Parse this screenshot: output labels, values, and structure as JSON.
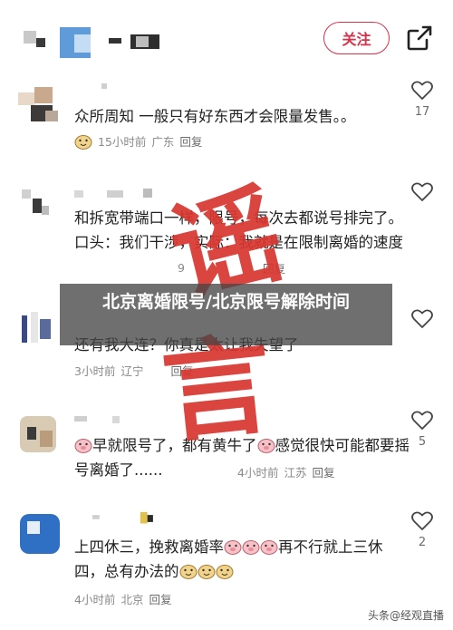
{
  "header": {
    "follow_label": "关注"
  },
  "comments": [
    {
      "text": "众所周知 一般只有好东西才会限量发售。。",
      "time": "15小时前",
      "location": "广东",
      "reply": "回复",
      "likes": "17"
    },
    {
      "text": "和拆宽带端口一样，限号，每次去都说号排完了。口头：我们干涉，实际：我就是在限制离婚的速度",
      "time": "9",
      "location": "",
      "reply": "回复",
      "likes": ""
    },
    {
      "text": "还有我大连？你真是太让我失望了",
      "time": "3小时前",
      "location": "辽宁",
      "reply": "回复",
      "likes": ""
    },
    {
      "text_part1": "早就限号了，都有黄牛了",
      "text_part2": "感觉很快可能都要摇号离婚了......",
      "time": "4小时前",
      "location": "江苏",
      "reply": "回复",
      "likes": "5"
    },
    {
      "text_part1": "上四休三，挽救离婚率",
      "text_part2": "再不行就上三休四，总有办法的",
      "time": "4小时前",
      "location": "北京",
      "reply": "回复",
      "likes": "2"
    }
  ],
  "stamp": {
    "char1": "谣",
    "char2": "言",
    "color": "#d9362f"
  },
  "banner_text": "北京离婚限号/北京限号解除时间",
  "watermark": "头条@经观直播",
  "colors": {
    "accent": "#d7324a",
    "meta": "#8a8a8a"
  }
}
